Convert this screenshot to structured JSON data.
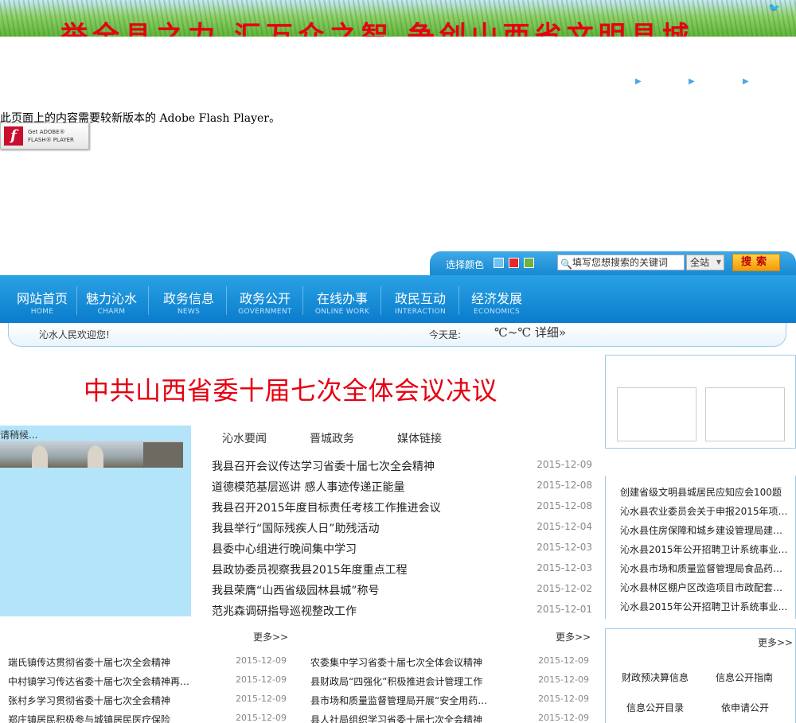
{
  "banner": {
    "slogan": "举全县之力 汇万众之智 争创山西省文明县城"
  },
  "flash": {
    "message": "此页面上的内容需要较新版本的 Adobe Flash Player。",
    "get_button": "Get ADOBE® FLASH® PLAYER"
  },
  "toolbar": {
    "color_label": "选择颜色",
    "colors": [
      "#6ec4f4",
      "#e8262c",
      "#6db33f"
    ],
    "search_placeholder": "填写您想搜索的关键词",
    "scope": "全站",
    "search_button": "搜索"
  },
  "nav": [
    {
      "cn": "网站首页",
      "en": "HOME"
    },
    {
      "cn": "魅力沁水",
      "en": "CHARM"
    },
    {
      "cn": "政务信息",
      "en": "NEWS"
    },
    {
      "cn": "政务公开",
      "en": "GOVERNMENT"
    },
    {
      "cn": "在线办事",
      "en": "ONLINE WORK"
    },
    {
      "cn": "政民互动",
      "en": "INTERACTION"
    },
    {
      "cn": "经济发展",
      "en": "ECONOMICS"
    }
  ],
  "welcome": {
    "greeting": "沁水人民欢迎您!",
    "today_label": "今天是:",
    "weather": "℃~℃ 详细»"
  },
  "headline": "中共山西省委十届七次全体会议决议",
  "photo": {
    "loading": "请稍候..."
  },
  "tabs": [
    "沁水要闻",
    "晋城政务",
    "媒体链接"
  ],
  "news": [
    {
      "title": "我县召开会议传达学习省委十届七次全会精神",
      "date": "2015-12-09"
    },
    {
      "title": "道德模范基层巡讲 感人事迹传递正能量",
      "date": "2015-12-08"
    },
    {
      "title": "我县召开2015年度目标责任考核工作推进会议",
      "date": "2015-12-08"
    },
    {
      "title": "我县举行“国际残疾人日”助残活动",
      "date": "2015-12-04"
    },
    {
      "title": "县委中心组进行晚间集中学习",
      "date": "2015-12-03"
    },
    {
      "title": "县政协委员视察我县2015年度重点工程",
      "date": "2015-12-03"
    },
    {
      "title": "我县荣膺“山西省级园林县城”称号",
      "date": "2015-12-02"
    },
    {
      "title": "范兆森调研指导巡视整改工作",
      "date": "2015-12-01"
    }
  ],
  "more_label": "更多>>",
  "left_list": [
    {
      "title": "端氏镇传达贯彻省委十届七次全会精神",
      "date": "2015-12-09"
    },
    {
      "title": "中村镇学习传达省委十届七次全会精神再…",
      "date": "2015-12-09"
    },
    {
      "title": "张村乡学习贯彻省委十届七次全会精神",
      "date": "2015-12-09"
    },
    {
      "title": "郑庄镇居民积极参与城镇居民医疗保险",
      "date": "2015-12-09"
    }
  ],
  "mid_list": [
    {
      "title": "农委集中学习省委十届七次全体会议精神",
      "date": "2015-12-09"
    },
    {
      "title": "县财政局“四强化”积极推进会计管理工作",
      "date": "2015-12-09"
    },
    {
      "title": "县市场和质量监督管理局开展“安全用药…",
      "date": "2015-12-09"
    },
    {
      "title": "县人社局组织学习省委十届七次全会精神",
      "date": "2015-12-09"
    }
  ],
  "notices": [
    "创建省级文明县城居民应知应会100题",
    "沁水县农业委员会关于申报2015年项…",
    "沁水县住房保障和城乡建设管理局建…",
    "沁水县2015年公开招聘卫计系统事业…",
    "沁水县市场和质量监督管理局食品药…",
    "沁水县林区棚户区改造项目市政配套…",
    "沁水县2015年公开招聘卫计系统事业…"
  ],
  "open_info": [
    "财政预决算信息",
    "信息公开指南",
    "信息公开目录",
    "依申请公开"
  ]
}
